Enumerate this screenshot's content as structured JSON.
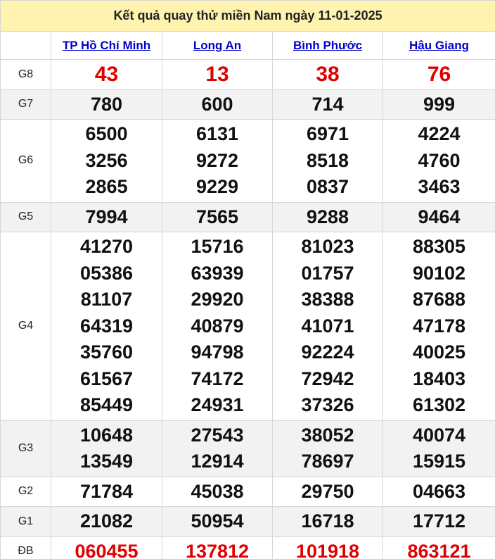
{
  "title": "Kết quả quay thử miền Nam ngày 11-01-2025",
  "provinces": [
    "TP Hồ Chí Minh",
    "Long An",
    "Bình Phước",
    "Hậu Giang"
  ],
  "prizes": [
    {
      "label": "G8",
      "values": [
        [
          "43"
        ],
        [
          "13"
        ],
        [
          "38"
        ],
        [
          "76"
        ]
      ]
    },
    {
      "label": "G7",
      "values": [
        [
          "780"
        ],
        [
          "600"
        ],
        [
          "714"
        ],
        [
          "999"
        ]
      ]
    },
    {
      "label": "G6",
      "values": [
        [
          "6500",
          "3256",
          "2865"
        ],
        [
          "6131",
          "9272",
          "9229"
        ],
        [
          "6971",
          "8518",
          "0837"
        ],
        [
          "4224",
          "4760",
          "3463"
        ]
      ]
    },
    {
      "label": "G5",
      "values": [
        [
          "7994"
        ],
        [
          "7565"
        ],
        [
          "9288"
        ],
        [
          "9464"
        ]
      ]
    },
    {
      "label": "G4",
      "values": [
        [
          "41270",
          "05386",
          "81107",
          "64319",
          "35760",
          "61567",
          "85449"
        ],
        [
          "15716",
          "63939",
          "29920",
          "40879",
          "94798",
          "74172",
          "24931"
        ],
        [
          "81023",
          "01757",
          "38388",
          "41071",
          "92224",
          "72942",
          "37326"
        ],
        [
          "88305",
          "90102",
          "87688",
          "47178",
          "40025",
          "18403",
          "61302"
        ]
      ]
    },
    {
      "label": "G3",
      "values": [
        [
          "10648",
          "13549"
        ],
        [
          "27543",
          "12914"
        ],
        [
          "38052",
          "78697"
        ],
        [
          "40074",
          "15915"
        ]
      ]
    },
    {
      "label": "G2",
      "values": [
        [
          "71784"
        ],
        [
          "45038"
        ],
        [
          "29750"
        ],
        [
          "04663"
        ]
      ]
    },
    {
      "label": "G1",
      "values": [
        [
          "21082"
        ],
        [
          "50954"
        ],
        [
          "16718"
        ],
        [
          "17712"
        ]
      ]
    },
    {
      "label": "ĐB",
      "values": [
        [
          "060455"
        ],
        [
          "137812"
        ],
        [
          "101918"
        ],
        [
          "863121"
        ]
      ]
    }
  ],
  "colors": {
    "title_bg": "#fff3b0",
    "link": "#0000cc",
    "special": "#e00000",
    "shade": "#f2f2f2"
  }
}
